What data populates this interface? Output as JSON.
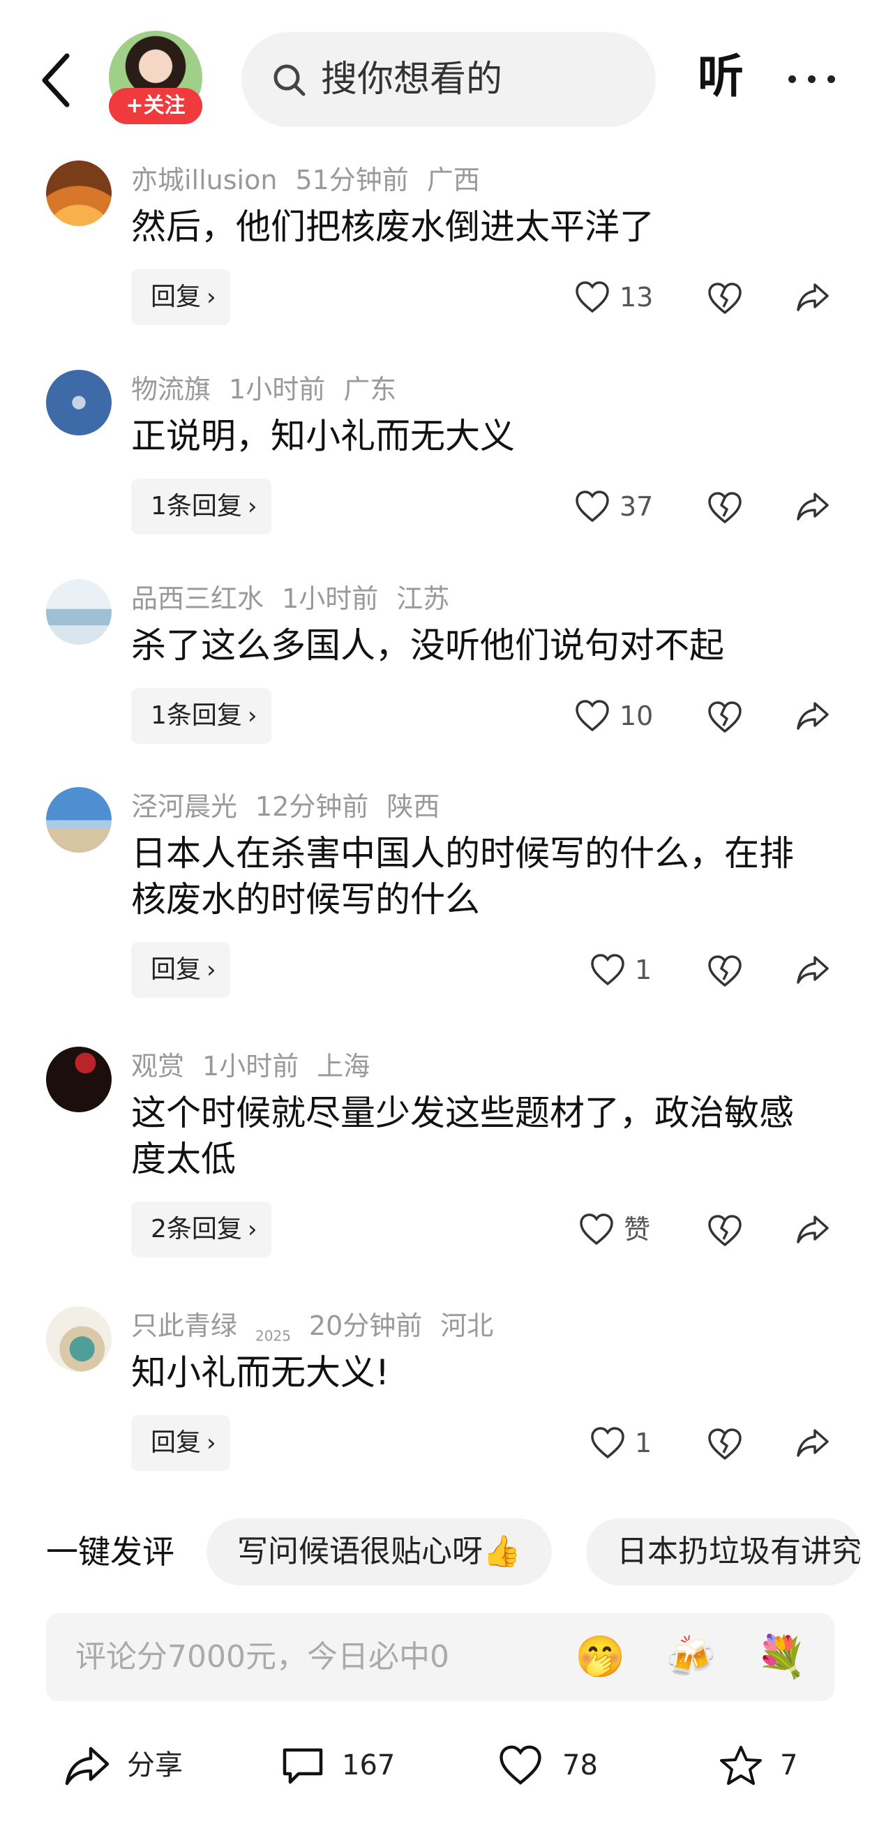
{
  "header": {
    "follow_label": "+关注",
    "search_placeholder": "搜你想看的",
    "listen_label": "听"
  },
  "comments": [
    {
      "user": "亦城illusion",
      "time": "51分钟前",
      "region": "广西",
      "text": "然后，他们把核废水倒进太平洋了",
      "reply_label": "回复",
      "likes": "13",
      "avatar": "sunset-silhouette"
    },
    {
      "user": "物流旗",
      "time": "1小时前",
      "region": "广东",
      "text": "正说明，知小礼而无大义",
      "reply_label": "1条回复",
      "likes": "37",
      "avatar": "fighter-jet"
    },
    {
      "user": "品西三红水",
      "time": "1小时前",
      "region": "江苏",
      "text": "杀了这么多国人，没听他们说句对不起",
      "reply_label": "1条回复",
      "likes": "10",
      "avatar": "ink-landscape"
    },
    {
      "user": "泾河晨光",
      "time": "12分钟前",
      "region": "陕西",
      "text": "日本人在杀害中国人的时候写的什么，在排核废水的时候写的什么",
      "reply_label": "回复",
      "likes": "1",
      "avatar": "beach-sky"
    },
    {
      "user": "观赏",
      "time": "1小时前",
      "region": "上海",
      "text": "这个时候就尽量少发这些题材了，政治敏感度太低",
      "reply_label": "2条回复",
      "likes": "赞",
      "avatar": "flag-night"
    },
    {
      "user": "只此青绿",
      "user_sub": "2025",
      "time": "20分钟前",
      "region": "河北",
      "text": "知小礼而无大义!",
      "reply_label": "回复",
      "likes": "1",
      "avatar": "painted-figure"
    }
  ],
  "quick_comment": {
    "label": "一键发评",
    "chips": [
      "写问候语很贴心呀👍",
      "日本扔垃圾有讲究"
    ]
  },
  "composer": {
    "placeholder": "评论分7000元，今日必中0",
    "emojis": [
      "🤭",
      "🍻",
      "💐"
    ]
  },
  "bottom_bar": {
    "share_label": "分享",
    "comments_count": "167",
    "likes_count": "78",
    "favorites_count": "7"
  },
  "colors": {
    "accent_red": "#f03a3e",
    "meta_gray": "#999999",
    "chip_bg": "#f2f2f2"
  }
}
